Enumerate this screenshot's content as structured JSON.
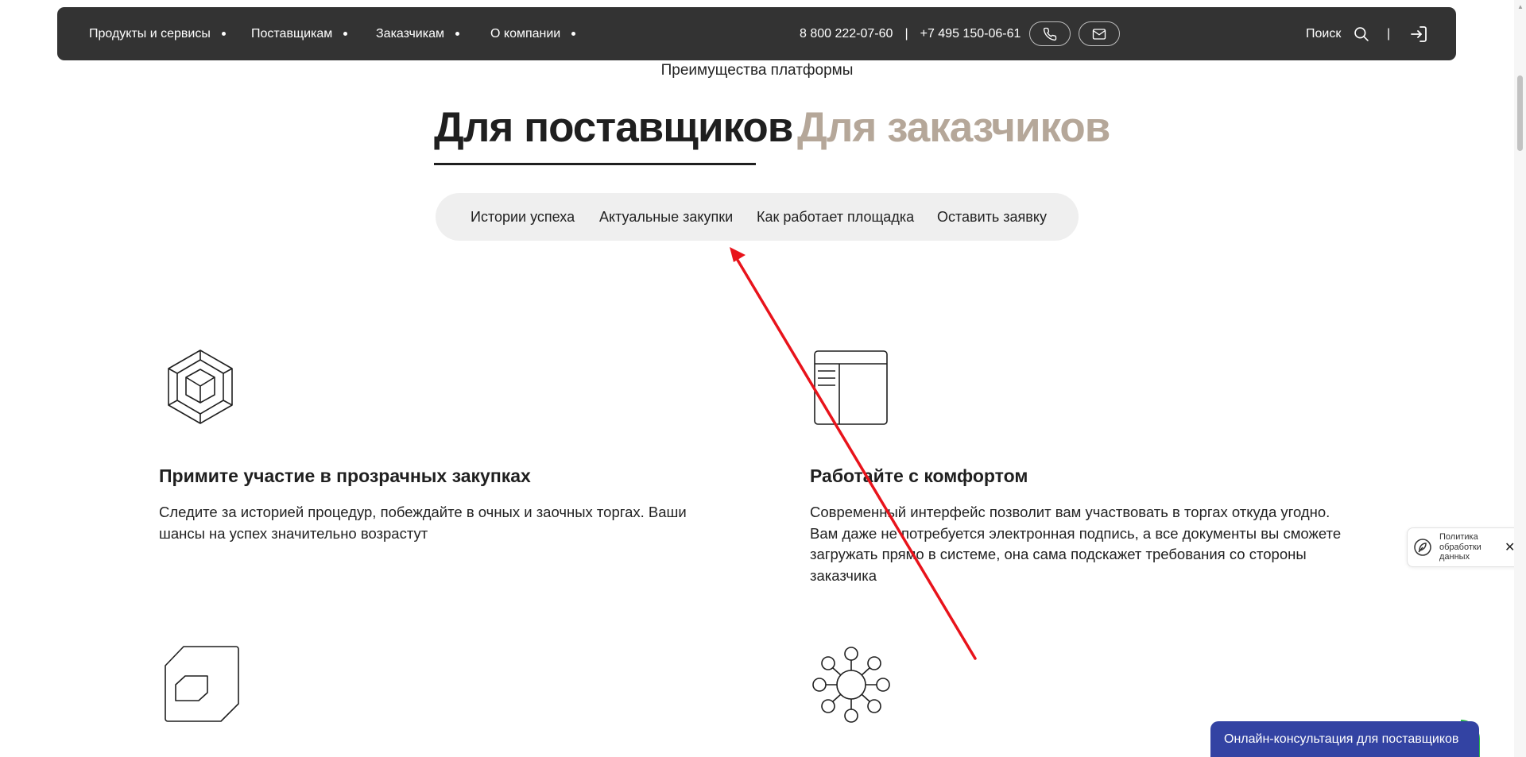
{
  "header": {
    "nav": [
      {
        "label": "Продукты и сервисы"
      },
      {
        "label": "Поставщикам"
      },
      {
        "label": "Заказчикам"
      },
      {
        "label": "О компании"
      }
    ],
    "phone_1": "8 800 222-07-60",
    "phone_separator": "|",
    "phone_2": "+7 495 150-06-61",
    "search_label": "Поиск",
    "divider": "|",
    "icons": [
      "phone-icon",
      "mail-icon",
      "search-icon",
      "login-icon"
    ]
  },
  "section": {
    "eyebrow": "Преимущества платформы",
    "tabs": [
      {
        "label": "Для поставщиков",
        "active": true
      },
      {
        "label": "Для заказчиков",
        "active": false
      }
    ],
    "subnav": [
      "Истории успеха",
      "Актуальные закупки",
      "Как работает площадка",
      "Оставить заявку"
    ]
  },
  "features": [
    {
      "icon": "cube-octagon-icon",
      "title": "Примите участие в прозрачных закупках",
      "text": "Следите за историей процедур, побеждайте в очных и заочных торгах. Ваши шансы на успех значительно возрастут"
    },
    {
      "icon": "window-layout-icon",
      "title": "Работайте с комфортом",
      "text": "Современный интерфейс позволит вам участвовать в торгах откуда угодно. Вам даже не потребуется электронная подпись, а все документы вы сможете загружать прямо в системе, она сама подскажет требования со стороны заказчика"
    },
    {
      "icon": "chip-shape-icon"
    },
    {
      "icon": "network-hub-icon"
    }
  ],
  "policy_popup": {
    "text": "Политика обработки данных",
    "close": "✕"
  },
  "chat": {
    "label": "Онлайн-консультация для поставщиков"
  },
  "colors": {
    "topbar": "#333333",
    "tab_inactive": "#b5a799",
    "subnav_bg": "#efefef",
    "chat_bg": "#3343a3",
    "chat_accent": "#2dbb48",
    "annotation_arrow": "#e8131b"
  }
}
